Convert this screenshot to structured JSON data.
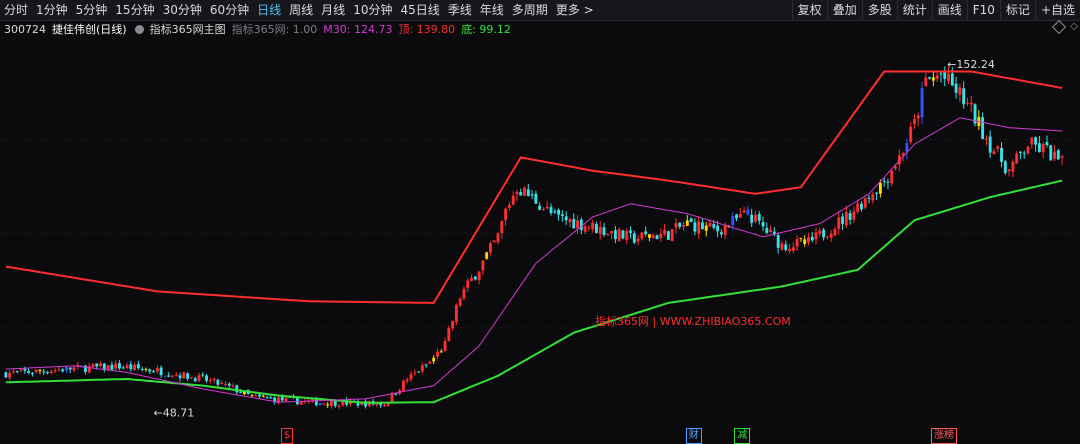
{
  "toolbar": {
    "periods": [
      "分时",
      "1分钟",
      "5分钟",
      "15分钟",
      "30分钟",
      "60分钟",
      "日线",
      "周线",
      "月线",
      "10分钟",
      "45日线",
      "季线",
      "年线",
      "多周期",
      "更多 >"
    ],
    "active_period": "日线",
    "tools": [
      "复权",
      "叠加",
      "多股",
      "统计",
      "画线",
      "F10",
      "标记",
      "+自选"
    ]
  },
  "infobar": {
    "code": "300724",
    "name": "捷佳伟创(日线)",
    "indicator": "指标365网主图",
    "indicator_param": "指标365网: 1.00",
    "m30_label": "M30: 124.73",
    "top_label": "顶: 139.80",
    "bottom_label": "底: 99.12"
  },
  "colors": {
    "up": "#ff2d2d",
    "down": "#39e1e8",
    "top_line": "#ff2d2d",
    "m30_line": "#d33bd3",
    "bottom_line": "#33e03a",
    "highlight": "#ffd700",
    "extra": "#3355ff"
  },
  "chart_data": {
    "type": "candlestick",
    "ylim": [
      44,
      158
    ],
    "high_marker": "152.24",
    "low_marker": "48.71",
    "watermark": "指标365网 | WWW.ZHIBIAO365.COM",
    "seeds": [
      [
        0,
        58.7
      ],
      [
        8,
        59.3
      ],
      [
        18,
        60.2
      ],
      [
        30,
        60.8
      ],
      [
        40,
        59.5
      ],
      [
        52,
        57.0
      ],
      [
        60,
        54.2
      ],
      [
        65,
        51.5
      ],
      [
        80,
        50.0
      ],
      [
        100,
        49.5
      ],
      [
        106,
        57.0
      ],
      [
        112,
        62.0
      ],
      [
        116,
        67.5
      ],
      [
        120,
        82.0
      ],
      [
        125,
        90.5
      ],
      [
        130,
        100.0
      ],
      [
        132,
        108.0
      ],
      [
        135,
        115.0
      ],
      [
        140,
        111.0
      ],
      [
        145,
        106.0
      ],
      [
        155,
        103.0
      ],
      [
        165,
        99.5
      ],
      [
        175,
        101.0
      ],
      [
        180,
        104.0
      ],
      [
        188,
        102.0
      ],
      [
        196,
        107.0
      ],
      [
        205,
        97.5
      ],
      [
        212,
        98.0
      ],
      [
        222,
        106.0
      ],
      [
        232,
        117.0
      ],
      [
        236,
        124.0
      ],
      [
        240,
        134.0
      ],
      [
        243,
        147.0
      ],
      [
        247,
        149.0
      ],
      [
        252,
        143.0
      ],
      [
        255,
        138.0
      ],
      [
        260,
        128.0
      ],
      [
        265,
        120.0
      ],
      [
        270,
        128.0
      ],
      [
        275,
        126.0
      ],
      [
        279,
        122.0
      ]
    ],
    "top_line": [
      [
        0,
        91.0
      ],
      [
        40,
        83.5
      ],
      [
        80,
        80.5
      ],
      [
        113,
        80.0
      ],
      [
        136,
        124.0
      ],
      [
        155,
        120.0
      ],
      [
        175,
        117.0
      ],
      [
        198,
        113.0
      ],
      [
        210,
        115.0
      ],
      [
        232,
        150.0
      ],
      [
        255,
        150.0
      ],
      [
        279,
        145.0
      ]
    ],
    "m30_line": [
      [
        0,
        60.0
      ],
      [
        18,
        61.0
      ],
      [
        32,
        59.0
      ],
      [
        52,
        54.0
      ],
      [
        72,
        50.0
      ],
      [
        95,
        51.0
      ],
      [
        113,
        55.0
      ],
      [
        125,
        67.0
      ],
      [
        140,
        92.0
      ],
      [
        155,
        106.0
      ],
      [
        165,
        110.0
      ],
      [
        180,
        107.0
      ],
      [
        200,
        100.0
      ],
      [
        215,
        104.0
      ],
      [
        228,
        113.0
      ],
      [
        240,
        128.0
      ],
      [
        252,
        136.0
      ],
      [
        265,
        133.0
      ],
      [
        279,
        132.0
      ]
    ],
    "bottom_line": [
      [
        0,
        56.0
      ],
      [
        32,
        57.0
      ],
      [
        52,
        55.0
      ],
      [
        72,
        52.0
      ],
      [
        95,
        49.8
      ],
      [
        113,
        50.0
      ],
      [
        130,
        58.0
      ],
      [
        150,
        71.0
      ],
      [
        175,
        80.0
      ],
      [
        205,
        85.0
      ],
      [
        225,
        90.0
      ],
      [
        240,
        105.0
      ],
      [
        260,
        112.0
      ],
      [
        279,
        117.0
      ]
    ],
    "markers": [
      {
        "label": "$",
        "color": "#ff3030",
        "pos": 0.26
      },
      {
        "label": "财",
        "color": "#4fa3ff",
        "pos": 0.635
      },
      {
        "label": "减",
        "color": "#33e03a",
        "pos": 0.68
      },
      {
        "label": "涨榜",
        "color": "#ff5a5a",
        "pos": 0.862
      }
    ]
  }
}
